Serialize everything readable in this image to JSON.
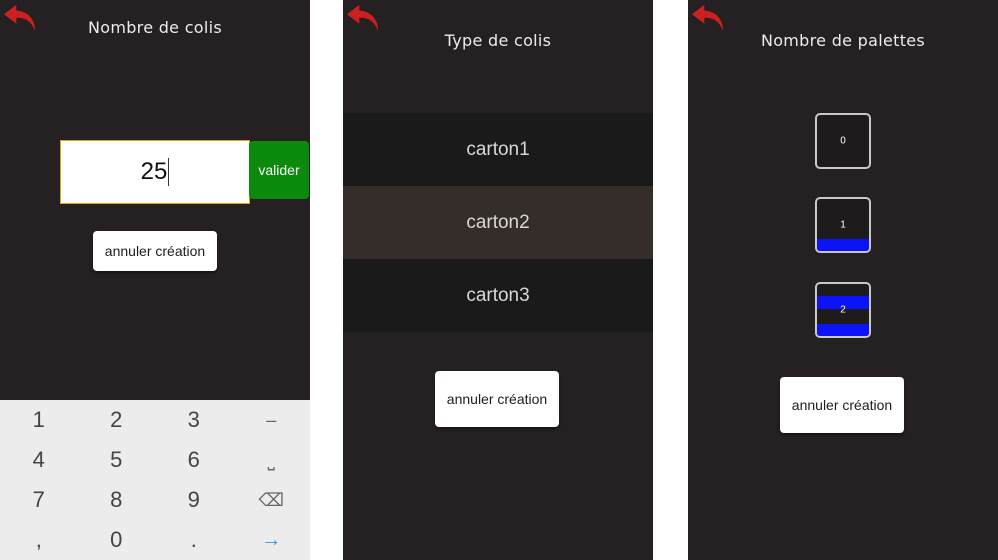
{
  "colors": {
    "screen_bg": "#252122",
    "back_arrow": "#cc2020",
    "valider_bg": "#0b8a0e",
    "input_border": "#e1a21a",
    "pallet_fill": "#0c13f7",
    "selected_row": "#342d2a"
  },
  "screen1": {
    "title": "Nombre de colis",
    "input_value": "25",
    "valider_label": "valider",
    "cancel_label": "annuler création",
    "keypad": [
      "1",
      "2",
      "3",
      "–",
      "4",
      "5",
      "6",
      "⎵",
      "7",
      "8",
      "9",
      "⌫",
      ",",
      "0",
      ".",
      "→"
    ]
  },
  "screen2": {
    "title": "Type de colis",
    "items": [
      {
        "label": "carton1",
        "selected": false
      },
      {
        "label": "carton2",
        "selected": true
      },
      {
        "label": "carton3",
        "selected": false
      }
    ],
    "cancel_label": "annuler création"
  },
  "screen3": {
    "title": "Nombre de palettes",
    "pallets": [
      {
        "label": "0"
      },
      {
        "label": "1"
      },
      {
        "label": "2"
      }
    ],
    "cancel_label": "annuler création"
  }
}
